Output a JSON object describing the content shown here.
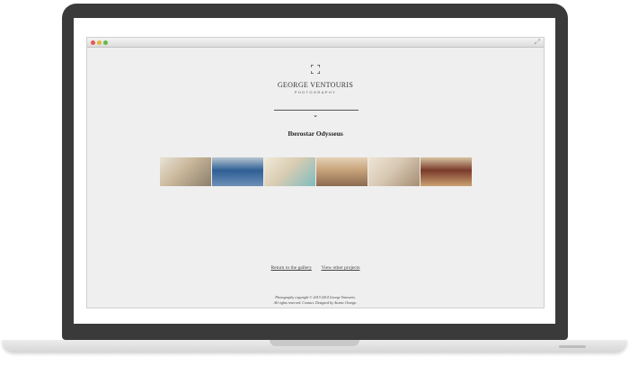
{
  "brand": {
    "name": "GEORGE VENTOURIS",
    "subtitle": "PHOTOGRAPHY"
  },
  "project": {
    "title": "Iberostar Odysseus"
  },
  "gallery": {
    "thumbnails": [
      {
        "subject": "hotel room with balcony view",
        "colors": [
          "#c9b79a",
          "#8a7e6c",
          "#e8e2d6"
        ]
      },
      {
        "subject": "sea and coastline view",
        "colors": [
          "#2f5f95",
          "#6d8fb7",
          "#b7c6cf"
        ]
      },
      {
        "subject": "pool at terrace",
        "colors": [
          "#d9ccb2",
          "#7fbcc0",
          "#f0ead9"
        ]
      },
      {
        "subject": "bedroom interior",
        "colors": [
          "#c7a27a",
          "#8b6a4f",
          "#e4d1b6"
        ]
      },
      {
        "subject": "suite with arched window",
        "colors": [
          "#d8c9b4",
          "#a58d73",
          "#efe5d6"
        ]
      },
      {
        "subject": "room with flowers and red accents",
        "colors": [
          "#7a3a2a",
          "#c9a070",
          "#d7c4a2"
        ]
      }
    ]
  },
  "links": {
    "return_label": "Return to the gallery",
    "other_label": "View other projects"
  },
  "footer": {
    "line1": "Photography copyright © 2013-2014 George Ventouris.",
    "line2": "All rights reserved. Contact. Designed by Atomic Orange."
  },
  "icons": {
    "logo": "corner-brackets-icon",
    "chevron": "chevron-down-icon",
    "fullscreen": "fullscreen-icon"
  }
}
